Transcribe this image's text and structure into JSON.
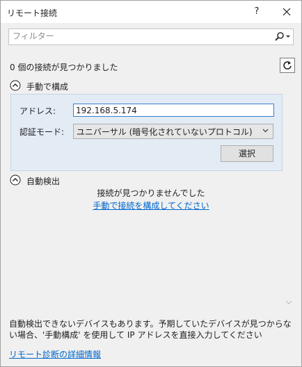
{
  "window": {
    "title": "リモート接続",
    "help_label": "?"
  },
  "filter": {
    "placeholder": "フィルター"
  },
  "status": {
    "found_count": "0 個の接続が見つかりました"
  },
  "manual_section": {
    "header": "手動で構成",
    "address_label": "アドレス:",
    "address_value": "192.168.5.174",
    "auth_label": "認証モード:",
    "auth_value": "ユニバーサル (暗号化されていないプロトコル)",
    "select_button": "選択"
  },
  "auto_section": {
    "header": "自動検出",
    "no_connections": "接続が見つかりませんでした",
    "manual_link": "手動で接続を構成してください"
  },
  "footer": {
    "info": "自動検出できないデバイスもあります。予期していたデバイスが見つからない場合、'手動構成' を使用して IP アドレスを直接入力してください",
    "details_link": "リモート診断の詳細情報"
  },
  "colors": {
    "link": "#0066cc",
    "panel": "#e3ebf5",
    "focus_border": "#3a7dd1"
  },
  "icons": [
    "close-icon",
    "search-icon",
    "refresh-icon",
    "collapse-icon",
    "chevron-down-icon"
  ]
}
